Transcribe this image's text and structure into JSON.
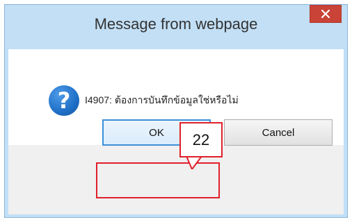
{
  "dialog": {
    "title": "Message from webpage",
    "close_icon": "×",
    "message": "I4907: ต้องการบันทึกข้อมูลใช่หรือไม่",
    "question_glyph": "?",
    "ok_label": "OK",
    "cancel_label": "Cancel"
  },
  "annotation": {
    "callout_number": "22"
  },
  "colors": {
    "accent": "#3c8fd9",
    "highlight": "#e0202a",
    "close_button": "#c94336"
  },
  "icons": {
    "close": "close-icon",
    "question": "question-icon"
  }
}
